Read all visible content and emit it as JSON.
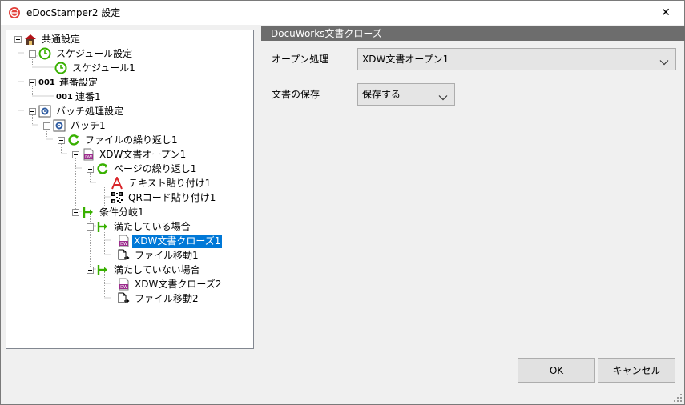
{
  "window": {
    "title": "eDocStamper2 設定",
    "close_glyph": "✕"
  },
  "tree": {
    "nodes": [
      {
        "label": "共通設定",
        "icon": "house-icon"
      },
      {
        "label": "スケジュール設定",
        "icon": "clock-icon"
      },
      {
        "label": "スケジュール1",
        "icon": "clock-icon"
      },
      {
        "label": "連番設定",
        "icon": "serial-number-icon",
        "icon_text": "001"
      },
      {
        "label": "連番1",
        "icon": "serial-number-icon",
        "icon_text": "001"
      },
      {
        "label": "バッチ処理設定",
        "icon": "batch-gear-icon"
      },
      {
        "label": "バッチ1",
        "icon": "batch-gear-icon"
      },
      {
        "label": "ファイルの繰り返し1",
        "icon": "loop-icon"
      },
      {
        "label": "XDW文書オープン1",
        "icon": "xdw-document-icon"
      },
      {
        "label": "ページの繰り返し1",
        "icon": "loop-icon"
      },
      {
        "label": "テキスト貼り付け1",
        "icon": "text-a-icon"
      },
      {
        "label": "QRコード貼り付け1",
        "icon": "qr-code-icon"
      },
      {
        "label": "条件分岐1",
        "icon": "branch-icon"
      },
      {
        "label": "満たしている場合",
        "icon": "branch-icon"
      },
      {
        "label": "XDW文書クローズ1",
        "icon": "xdw-document-icon",
        "selected": true
      },
      {
        "label": "ファイル移動1",
        "icon": "file-move-icon"
      },
      {
        "label": "満たしていない場合",
        "icon": "branch-icon"
      },
      {
        "label": "XDW文書クローズ2",
        "icon": "xdw-document-icon"
      },
      {
        "label": "ファイル移動2",
        "icon": "file-move-icon"
      }
    ]
  },
  "panel": {
    "header": "DocuWorks文書クローズ",
    "open_process_label": "オープン処理",
    "open_process_value": "XDW文書オープン1",
    "save_label": "文書の保存",
    "save_value": "保存する"
  },
  "buttons": {
    "ok": "OK",
    "cancel": "キャンセル"
  },
  "colors": {
    "selection": "#0078d7",
    "section_header_bg": "#6d6d6d",
    "icon_green": "#38b000",
    "icon_red": "#d9262b"
  }
}
